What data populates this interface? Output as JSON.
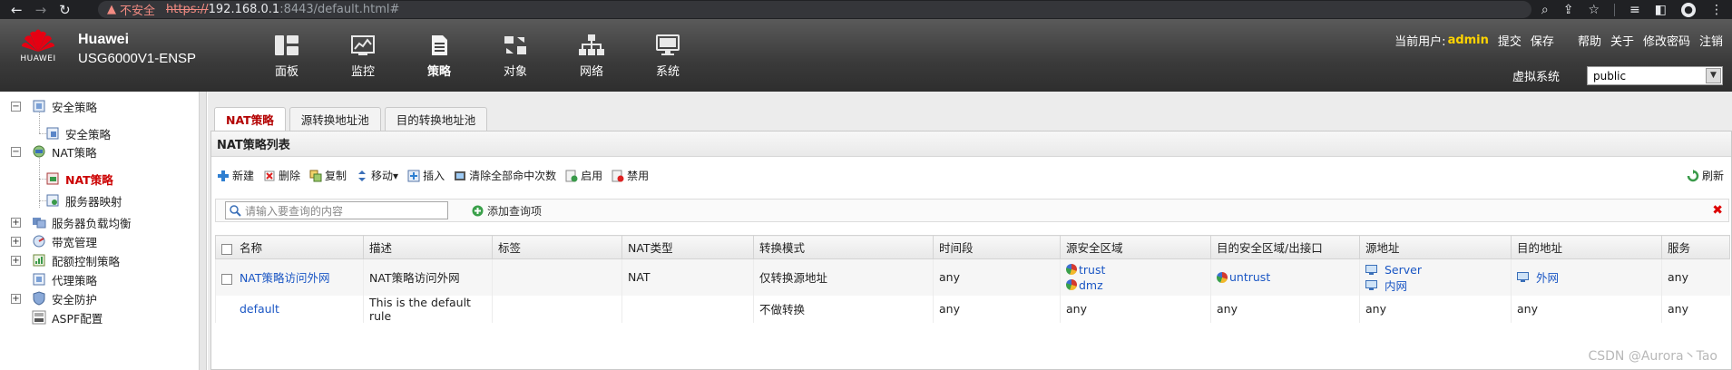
{
  "browser": {
    "security_label": "不安全",
    "url_protocol": "https://",
    "url_host": "192.168.0.1",
    "url_path": ":8443/default.html#"
  },
  "header": {
    "logo_text": "HUAWEI",
    "brand": "Huawei",
    "model": "USG6000V1-ENSP",
    "menu": [
      {
        "label": "面板",
        "icon": "dashboard-icon"
      },
      {
        "label": "监控",
        "icon": "monitor-chart-icon"
      },
      {
        "label": "策略",
        "icon": "policy-document-icon"
      },
      {
        "label": "对象",
        "icon": "object-icon"
      },
      {
        "label": "网络",
        "icon": "network-icon"
      },
      {
        "label": "系统",
        "icon": "system-computer-icon"
      }
    ],
    "active_menu": "策略",
    "current_user_label": "当前用户:",
    "current_user": "admin",
    "links": [
      "提交",
      "保存",
      "帮助",
      "关于",
      "修改密码",
      "注销"
    ],
    "vsys_label": "虚拟系统",
    "vsys_value": "public"
  },
  "sidebar": {
    "items": [
      {
        "label": "安全策略",
        "level": 0,
        "expand": "−"
      },
      {
        "label": "安全策略",
        "level": 1
      },
      {
        "label": "NAT策略",
        "level": 0,
        "expand": "−"
      },
      {
        "label": "NAT策略",
        "level": 1,
        "selected": true
      },
      {
        "label": "服务器映射",
        "level": 1
      },
      {
        "label": "服务器负载均衡",
        "level": 0,
        "expand": "+"
      },
      {
        "label": "带宽管理",
        "level": 0,
        "expand": "+"
      },
      {
        "label": "配额控制策略",
        "level": 0,
        "expand": "+"
      },
      {
        "label": "代理策略",
        "level": 0
      },
      {
        "label": "安全防护",
        "level": 0,
        "expand": "+"
      },
      {
        "label": "ASPF配置",
        "level": 0
      }
    ]
  },
  "tabs": [
    "NAT策略",
    "源转换地址池",
    "目的转换地址池"
  ],
  "panel": {
    "title": "NAT策略列表",
    "toolbar": [
      "新建",
      "删除",
      "复制",
      "移动▾",
      "插入",
      "清除全部命中次数",
      "启用",
      "禁用"
    ],
    "refresh": "刷新",
    "search_placeholder": "请输入要查询的内容",
    "add_query": "添加查询项"
  },
  "table": {
    "columns": [
      "名称",
      "描述",
      "标签",
      "NAT类型",
      "转换模式",
      "时间段",
      "源安全区域",
      "目的安全区域/出接口",
      "源地址",
      "目的地址",
      "服务"
    ],
    "rows": [
      {
        "name": "NAT策略访问外网",
        "desc": "NAT策略访问外网",
        "tag": "",
        "nat_type": "NAT",
        "mode": "仅转换源地址",
        "time": "any",
        "src_zone": [
          "trust",
          "dmz"
        ],
        "dst_zone": "untrust",
        "src_addr": [
          "Server",
          "内网"
        ],
        "dst_addr": "外网",
        "service": "any"
      },
      {
        "name": "default",
        "desc": "This is the default rule",
        "tag": "",
        "nat_type": "",
        "mode": "不做转换",
        "time": "any",
        "src_zone": "any",
        "dst_zone": "any",
        "src_addr": "any",
        "dst_addr": "any",
        "service": "any"
      }
    ]
  },
  "watermark": "CSDN @Aurora丶Tao"
}
